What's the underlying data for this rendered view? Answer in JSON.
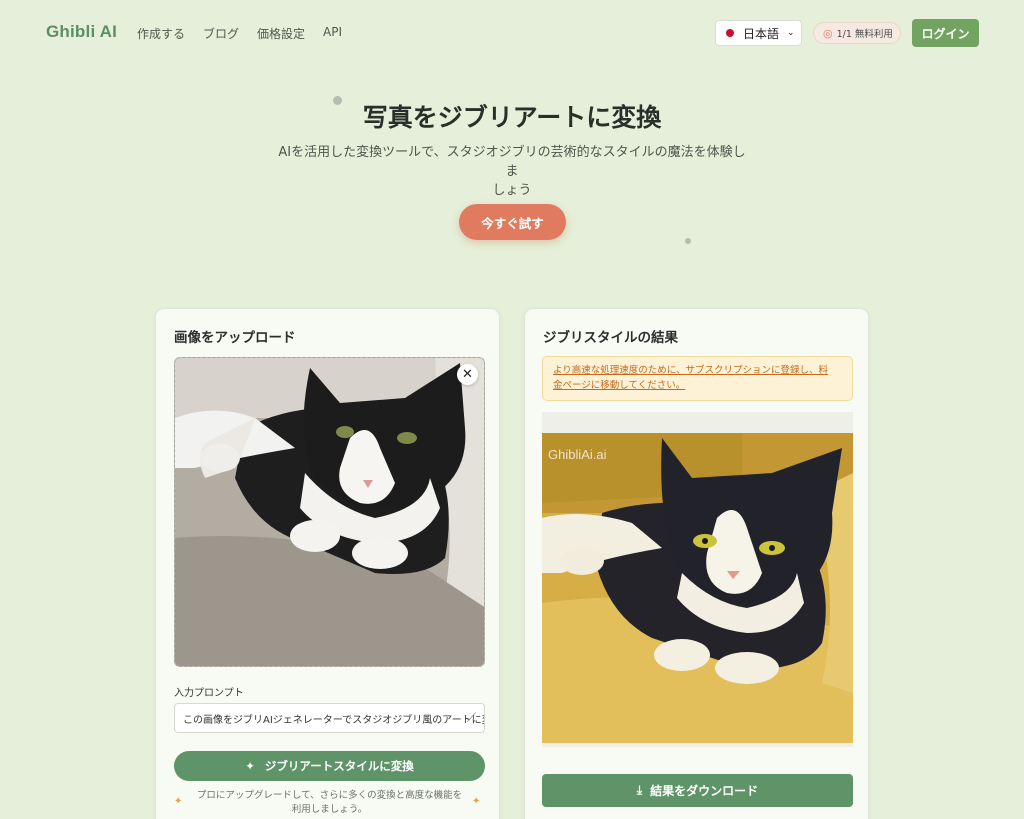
{
  "nav": {
    "logo": "Ghibli AI",
    "links": [
      "作成する",
      "ブログ",
      "価格設定",
      "API"
    ],
    "language": "日本語",
    "free_usage": "1/1 無料利用",
    "login": "ログイン"
  },
  "hero": {
    "title": "写真をジブリアートに変換",
    "subtitle_line1": "AIを活用した変換ツールで、スタジオジブリの芸術的なスタイルの魔法を体験しま",
    "subtitle_line2": "しょう",
    "cta": "今すぐ試す"
  },
  "upload_card": {
    "title": "画像をアップロード",
    "close": "✕",
    "prompt_label": "入力プロンプト",
    "prompt_value": "この画像をジブリAIジェネレーターでスタジオジブリ風のアートに変換してください",
    "convert_button": "ジブリアートスタイルに変換",
    "upgrade_line1": "プロにアップグレードして、さらに多くの変換と高度な機能を",
    "upgrade_line2": "利用しましょう。"
  },
  "result_card": {
    "title": "ジブリスタイルの結果",
    "notice_line1": "より高速な処理速度のために、サブスクリプションに登録し、料",
    "notice_line2": "金ページに移動してください。",
    "watermark": "GhibliAi.ai",
    "download_button": "結果をダウンロード"
  },
  "colors": {
    "background": "#e6efd9",
    "brand_green": "#5f9468",
    "accent_orange": "#e07b5f",
    "login_green": "#73a360"
  },
  "icons": [
    "chevron-down-icon",
    "coin-icon",
    "close-icon",
    "magic-wand-icon",
    "sparkle-icon",
    "download-icon"
  ]
}
